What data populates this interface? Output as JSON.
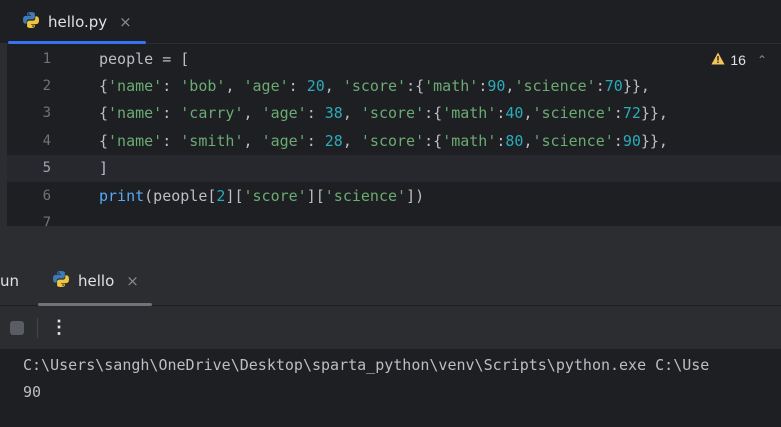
{
  "editor_tab": {
    "filename": "hello.py",
    "close": "×"
  },
  "warnings": {
    "count": "16"
  },
  "line_numbers": [
    "1",
    "2",
    "3",
    "4",
    "5",
    "6",
    "7"
  ],
  "code": {
    "l1": {
      "t1": "people = ["
    },
    "l2": {
      "t1": "{",
      "t2": "'name'",
      "t3": ": ",
      "t4": "'bob'",
      "t5": ", ",
      "t6": "'age'",
      "t7": ": ",
      "t8": "20",
      "t9": ", ",
      "t10": "'score'",
      "t11": ":{",
      "t12": "'math'",
      "t13": ":",
      "t14": "90",
      "t15": ",",
      "t16": "'science'",
      "t17": ":",
      "t18": "70",
      "t19": "}},"
    },
    "l3": {
      "t1": "{",
      "t2": "'name'",
      "t3": ": ",
      "t4": "'carry'",
      "t5": ", ",
      "t6": "'age'",
      "t7": ": ",
      "t8": "38",
      "t9": ", ",
      "t10": "'score'",
      "t11": ":{",
      "t12": "'math'",
      "t13": ":",
      "t14": "40",
      "t15": ",",
      "t16": "'science'",
      "t17": ":",
      "t18": "72",
      "t19": "}},"
    },
    "l4": {
      "t1": "{",
      "t2": "'name'",
      "t3": ": ",
      "t4": "'smith'",
      "t5": ", ",
      "t6": "'age'",
      "t7": ": ",
      "t8": "28",
      "t9": ", ",
      "t10": "'score'",
      "t11": ":{",
      "t12": "'math'",
      "t13": ":",
      "t14": "80",
      "t15": ",",
      "t16": "'science'",
      "t17": ":",
      "t18": "90",
      "t19": "}},"
    },
    "l5": {
      "t1": "]"
    },
    "l6": {
      "t1": "print",
      "t2": "(people[",
      "t3": "2",
      "t4": "][",
      "t5": "'score'",
      "t6": "][",
      "t7": "'science'",
      "t8": "])"
    }
  },
  "run_panel": {
    "title": "un",
    "tab_label": "hello",
    "tab_close": "×",
    "more_label": "⋮",
    "console_lines": [
      "C:\\Users\\sangh\\OneDrive\\Desktop\\sparta_python\\venv\\Scripts\\python.exe C:\\Use",
      "90"
    ]
  },
  "colors": {
    "background": "#1e1f22",
    "panel": "#2b2d30",
    "string": "#6aab73",
    "number": "#2aacb8",
    "function": "#56a8f5",
    "accent": "#3574f0",
    "warning": "#f2c55c"
  },
  "icons": [
    "python-file-icon",
    "warning-icon",
    "stop-icon",
    "more-options-icon"
  ]
}
